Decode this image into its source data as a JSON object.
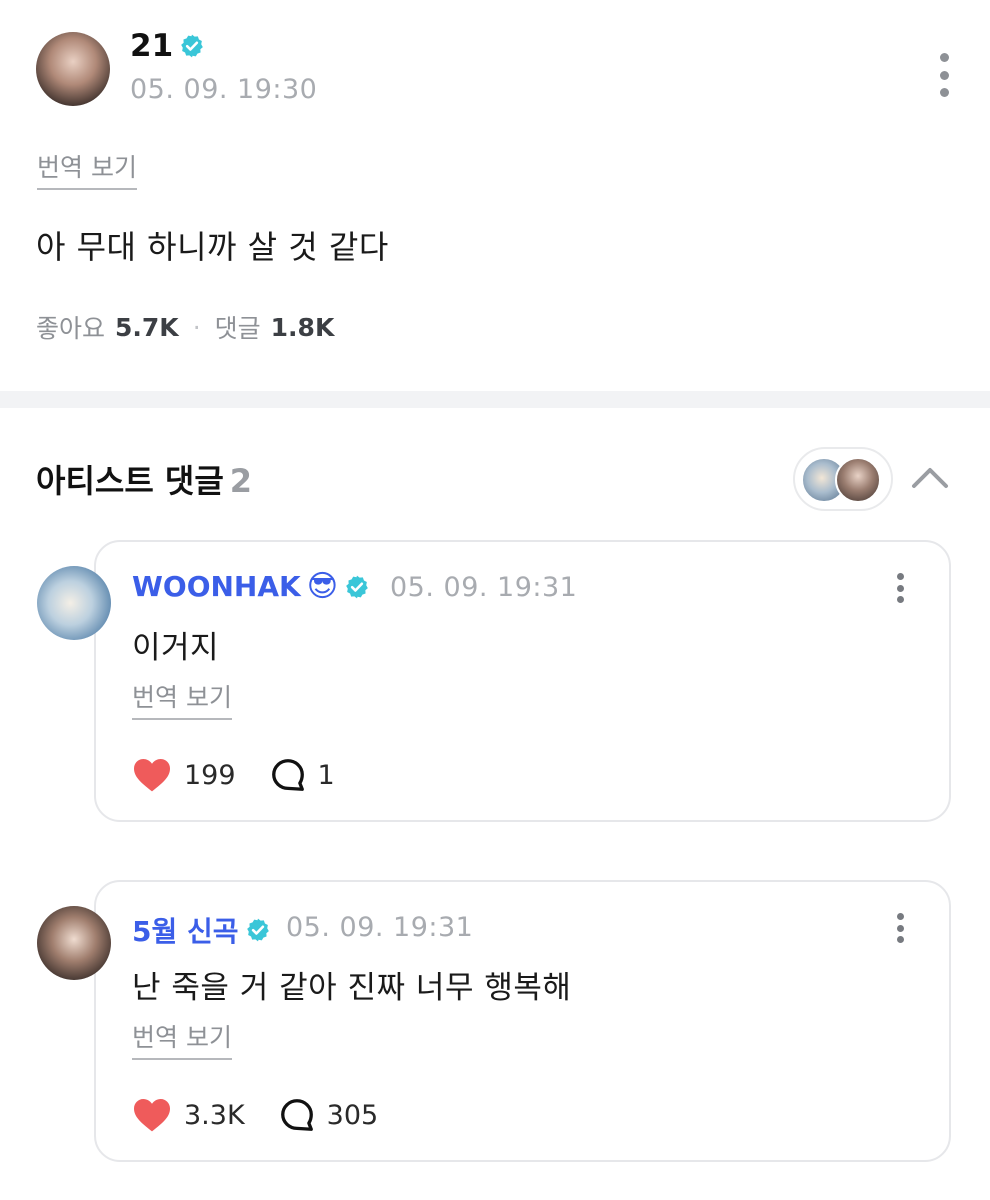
{
  "post": {
    "author": "21",
    "timestamp": "05. 09. 19:30",
    "translate_label": "번역 보기",
    "body": "아 무대 하니까 살 것 같다",
    "likes_label": "좋아요",
    "likes_count": "5.7K",
    "comments_label": "댓글",
    "comments_count": "1.8K",
    "separator": "·"
  },
  "artist_comments": {
    "title": "아티스트 댓글",
    "count": "2",
    "items": [
      {
        "author": "WOONHAK",
        "author_emoji": "😎",
        "timestamp": "05. 09. 19:31",
        "text": "이거지",
        "translate_label": "번역 보기",
        "likes": "199",
        "replies": "1"
      },
      {
        "author": "5월 신곡",
        "author_emoji": "",
        "timestamp": "05. 09. 19:31",
        "text": "난 죽을 거 같아 진짜 너무 행복해",
        "translate_label": "번역 보기",
        "likes": "3.3K",
        "replies": "305"
      }
    ]
  },
  "colors": {
    "verified": "#3ac6d8",
    "author_link": "#3b5ee8",
    "heart": "#ef5b5b",
    "muted": "#a8abb0"
  },
  "icons": [
    "verified-badge-icon",
    "more-icon",
    "chevron-up-icon",
    "heart-icon",
    "comment-bubble-icon"
  ]
}
